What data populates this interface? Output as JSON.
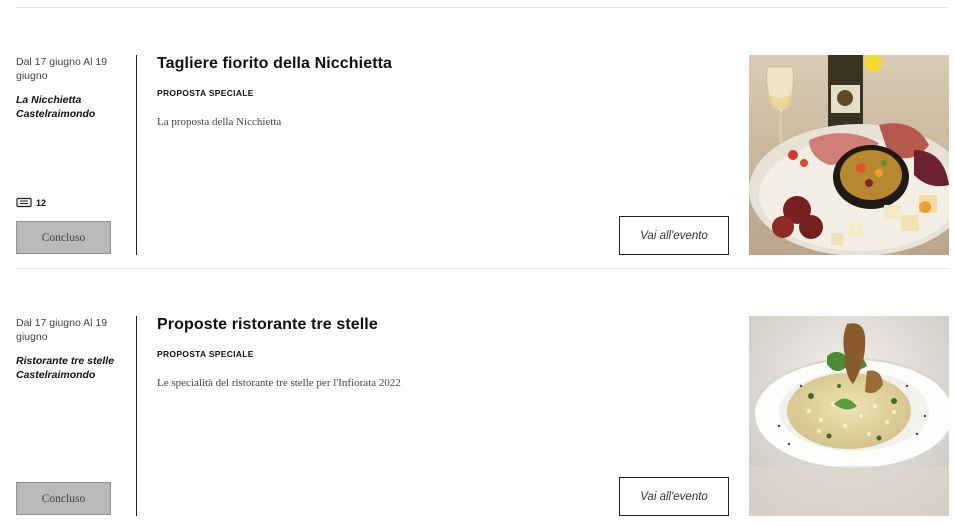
{
  "events": [
    {
      "date": "Dal 17 giugno Al 19 giugno",
      "place": "La Nicchietta Castelraimondo",
      "title": "Tagliere fiorito della Nicchietta",
      "category": "PROPOSTA SPECIALE",
      "description": "La proposta della Nicchietta",
      "tickets": "12",
      "status": "Concluso",
      "cta": "Vai all'evento",
      "image_icon": "charcuterie-board-photo"
    },
    {
      "date": "Dal 17 giugno Al 19 giugno",
      "place": "Ristorante tre stelle Castelraimondo",
      "title": "Proposte ristorante tre stelle",
      "category": "PROPOSTA SPECIALE",
      "description": "Le specialità del ristorante tre stelle per l'Infiorata 2022",
      "status": "Concluso",
      "cta": "Vai all'evento",
      "image_icon": "risotto-dish-photo"
    }
  ]
}
